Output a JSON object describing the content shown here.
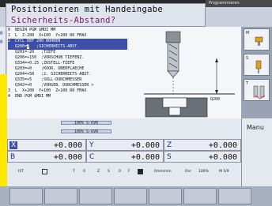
{
  "header": {
    "title": "Positionieren mit Handeingabe",
    "prompt": "Sicherheits-Abstand?",
    "secondary_mode": "Programmieren"
  },
  "left_strip": [
    "0",
    "0"
  ],
  "program": {
    "lines": [
      {
        "text": "0  BEGIN PGM $MDI MM",
        "selected": false
      },
      {
        "text": "1  L  Z-200  X+100  Y+200 R0 FMAX",
        "selected": false
      },
      {
        "text": "2  CYCL DEF 200 BOHREN",
        "selected": true
      },
      {
        "text": "   Q200=",
        "selected": true,
        "cursor": "2",
        "param_label": "   ;SICHERHEITS-ABST."
      },
      {
        "text": "   Q201=-20   ;TIEFE",
        "selected": false
      },
      {
        "text": "   Q206=+150  ;VORSCHUB TIEFENZ.",
        "selected": false
      },
      {
        "text": "   Q334=+0.25 ;ZUSTELL-TIEFE",
        "selected": false
      },
      {
        "text": "   Q203=+0    ;KOOR. OBERFLAECHE",
        "selected": false
      },
      {
        "text": "   Q204=+50   ;2. SICHERHEITS-ABST.",
        "selected": false
      },
      {
        "text": "   Q335=+5    ;SOLL-DURCHMESSER",
        "selected": false
      },
      {
        "text": "   Q342=+0    ;VORGEB. DURCHMESSER >",
        "selected": false
      },
      {
        "text": "3  L  X+200  Y+100  Z+100 R0 FMAX",
        "selected": false
      },
      {
        "text": "4  END PGM $MDI MM",
        "selected": false
      }
    ]
  },
  "graphic": {
    "param_label": "Q200"
  },
  "override": {
    "line1": "100% S-OVR",
    "line2": "100% S-OVR"
  },
  "positions": [
    {
      "axis": "X",
      "value": "+0.000",
      "active": true
    },
    {
      "axis": "Y",
      "value": "+0.000",
      "active": false
    },
    {
      "axis": "Z",
      "value": "+0.000",
      "active": false
    },
    {
      "axis": "B",
      "value": "+0.000",
      "active": false
    },
    {
      "axis": "C",
      "value": "+0.000",
      "active": false
    },
    {
      "axis": "S",
      "value": "+0.000",
      "active": false
    }
  ],
  "status": {
    "ist": "IST",
    "t": "T",
    "zero": "0",
    "z": "Z",
    "s": "S",
    "f": "F",
    "feed_unit": "0mm/min",
    "ovr": "Ovr",
    "ovr_pct": "100%",
    "m": "M 5/9"
  },
  "manual_panel": {
    "label": "Manu"
  },
  "colors": {
    "selection": "#3c4ea8",
    "cursor_param": "#d63f8a",
    "prompt_text": "#7a1a6a",
    "background": "#c9d0dc",
    "yellow_indicator": "#ffe800"
  }
}
